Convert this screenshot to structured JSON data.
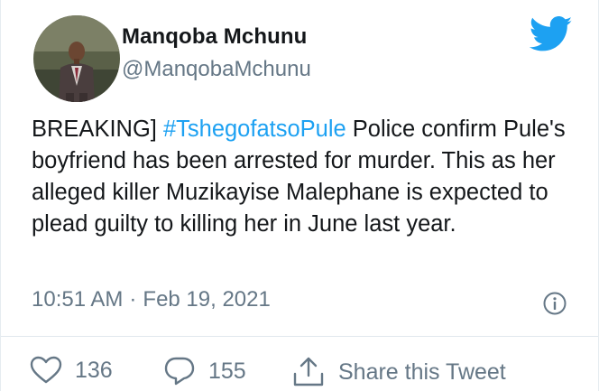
{
  "author": {
    "name": "Manqoba Mchunu",
    "handle": "@ManqobaMchunu"
  },
  "tweet": {
    "text_before": "BREAKING] ",
    "hashtag": "#TshegofatsoPule",
    "text_after": " Police confirm Pule's boyfriend has been arrested for murder. This as her alleged killer Muzikayise Malephane is expected to plead guilty to killing her in June last year.",
    "time": "10:51 AM",
    "separator": "·",
    "date": "Feb 19, 2021"
  },
  "actions": {
    "likes": "136",
    "replies": "155",
    "share_label": "Share this Tweet"
  },
  "icons": [
    "twitter-bird-icon",
    "info-icon",
    "heart-icon",
    "reply-bubble-icon",
    "share-icon"
  ],
  "colors": {
    "accent": "#1da1f2",
    "text": "#14171a",
    "muted": "#657786"
  }
}
